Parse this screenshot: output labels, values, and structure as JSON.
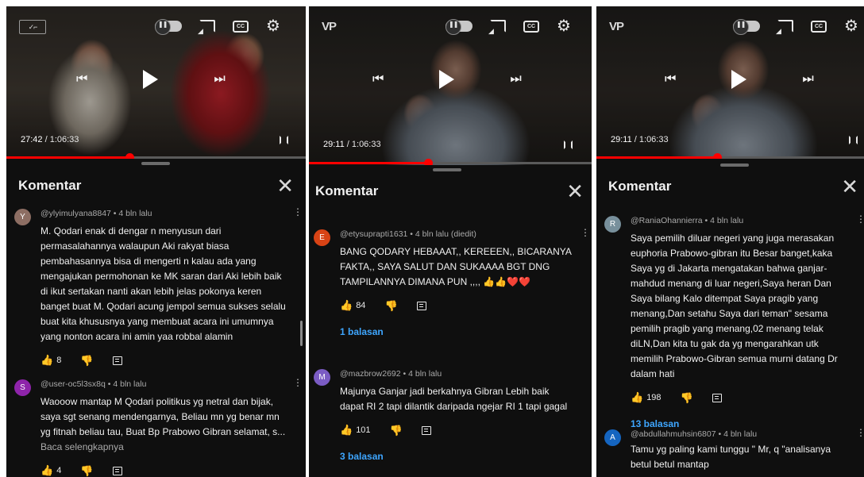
{
  "panels": [
    {
      "logo": "",
      "time_current": "27:42",
      "time_total": "1:06:33",
      "header_title": "Komentar",
      "comments": [
        {
          "avatar_letter": "Y",
          "avatar_color": "#8d6e63",
          "meta": "@ylyimulyana8847 • 4 bln lalu",
          "text": "M. Qodari enak di dengar n menyusun dari permasalahannya walaupun Aki rakyat biasa pembahasannya bisa di mengerti n kalau ada yang mengajukan permohonan ke MK saran dari Aki lebih baik di ikut sertakan nanti akan lebih jelas pokonya keren banget buat M. Qodari acung jempol semua sukses selalu buat kita khususnya yang membuat acara ini umumnya yang nonton acara ini amin yaa robbal alamin",
          "more": "",
          "likes": "8",
          "replies": ""
        },
        {
          "avatar_letter": "S",
          "avatar_color": "#8e24aa",
          "meta": "@user-oc5l3sx8q • 4 bln lalu",
          "text": "Waooow mantap M Qodari politikus yg netral dan bijak, saya sgt senang mendengarnya, Beliau mn yg benar mn yg fitnah beliau tau, Buat Bp Prabowo Gibran selamat, s...",
          "more": "Baca selengkapnya",
          "likes": "4",
          "replies": ""
        }
      ]
    },
    {
      "logo": "VP",
      "time_current": "29:11",
      "time_total": "1:06:33",
      "header_title": "Komentar",
      "comments": [
        {
          "avatar_letter": "E",
          "avatar_color": "#d84315",
          "meta": "@etysuprapti1631 • 4 bln lalu (diedit)",
          "text": "BANG QODARY HEBAAAT,, KEREEEN,, BICARANYA FAKTA,, SAYA SALUT DAN SUKAAAA BGT DNG TAMPILANNYA DIMANA PUN ,,,, 👍👍❤️❤️",
          "more": "",
          "likes": "84",
          "replies": "1 balasan"
        },
        {
          "avatar_letter": "M",
          "avatar_color": "#7b5cc4",
          "meta": "@mazbrow2692 • 4 bln lalu",
          "text": "Majunya Ganjar jadi berkahnya Gibran Lebih baik dapat RI 2 tapi dilantik daripada ngejar RI 1 tapi gagal",
          "more": "",
          "likes": "101",
          "replies": "3 balasan"
        }
      ]
    },
    {
      "logo": "VP",
      "time_current": "29:11",
      "time_total": "1:06:33",
      "header_title": "Komentar",
      "comments": [
        {
          "avatar_letter": "R",
          "avatar_color": "#78909c",
          "meta": "@RaniaOhannierra • 4 bln lalu",
          "text": "Saya pemilih diluar negeri yang juga merasakan euphoria Prabowo-gibran itu Besar banget,kaka Saya yg di Jakarta mengatakan bahwa ganjar-mahdud menang di luar negeri,Saya heran Dan Saya bilang Kalo ditempat Saya pragib yang menang,Dan setahu Saya dari teman\" sesama pemilih pragib yang menang,02 menang telak diLN,Dan kita tu gak da yg mengarahkan utk memilih Prabowo-Gibran semua murni datang Dr dalam hati",
          "more": "",
          "likes": "198",
          "replies": "13 balasan"
        },
        {
          "avatar_letter": "A",
          "avatar_color": "#1565c0",
          "meta": "@abdullahmuhsin6807 • 4 bln lalu",
          "text": "Tamu yg paling kami tunggu \" Mr, q \"analisanya betul betul mantap",
          "more": "",
          "likes": "",
          "replies": ""
        }
      ]
    }
  ]
}
